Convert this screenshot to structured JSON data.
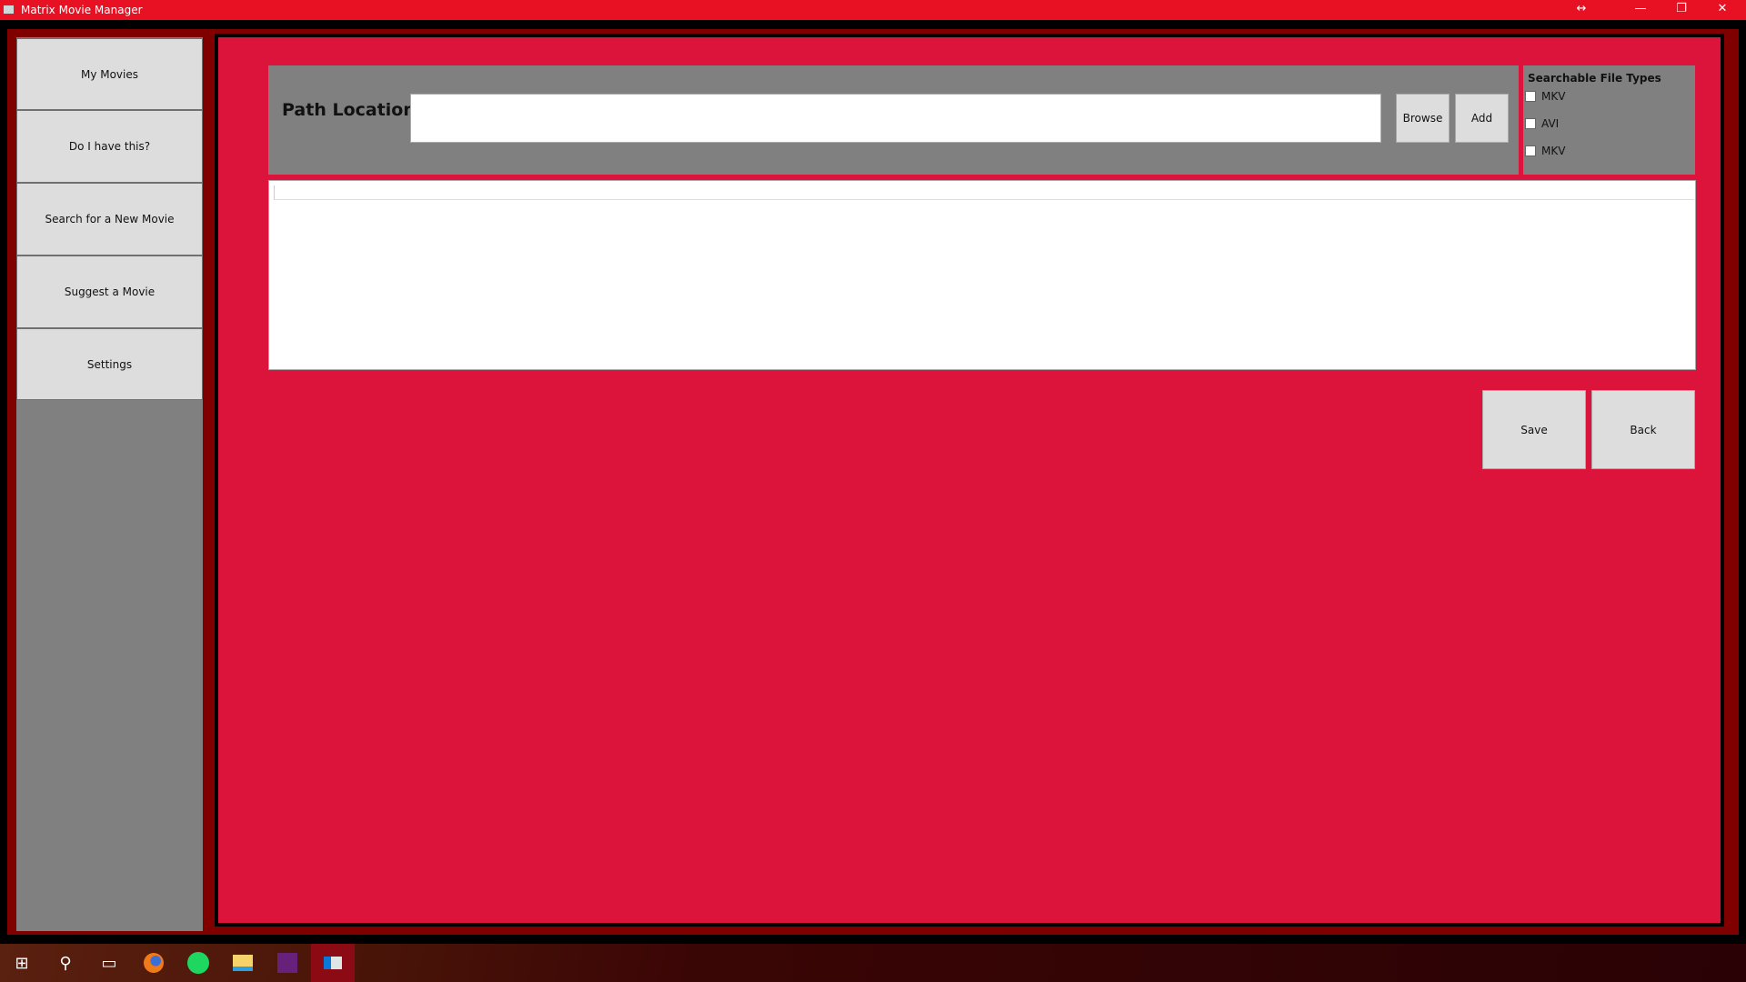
{
  "window": {
    "title": "Matrix Movie Manager",
    "controls": {
      "resize": "↔",
      "minimize": "—",
      "restore": "❐",
      "close": "✕"
    }
  },
  "sidebar": {
    "items": [
      {
        "label": "My Movies"
      },
      {
        "label": "Do I have this?"
      },
      {
        "label": "Search for a New Movie"
      },
      {
        "label": "Suggest a Movie"
      },
      {
        "label": "Settings"
      }
    ]
  },
  "path": {
    "label": "Path Location:",
    "value": "",
    "browse": "Browse",
    "add": "Add"
  },
  "file_types": {
    "title": "Searchable File Types",
    "options": [
      {
        "label": "MKV",
        "checked": false
      },
      {
        "label": "AVI",
        "checked": false
      },
      {
        "label": "MKV",
        "checked": false
      }
    ]
  },
  "actions": {
    "save": "Save",
    "back": "Back"
  },
  "taskbar": {
    "icons": [
      "windows-start-icon",
      "search-icon",
      "task-view-icon",
      "firefox-icon",
      "spotify-icon",
      "file-explorer-icon",
      "visual-studio-icon",
      "matrix-movie-manager-icon"
    ]
  },
  "colors": {
    "titlebar": "#e81123",
    "main": "#dc143c",
    "frame": "#800000",
    "panel": "#808080"
  }
}
